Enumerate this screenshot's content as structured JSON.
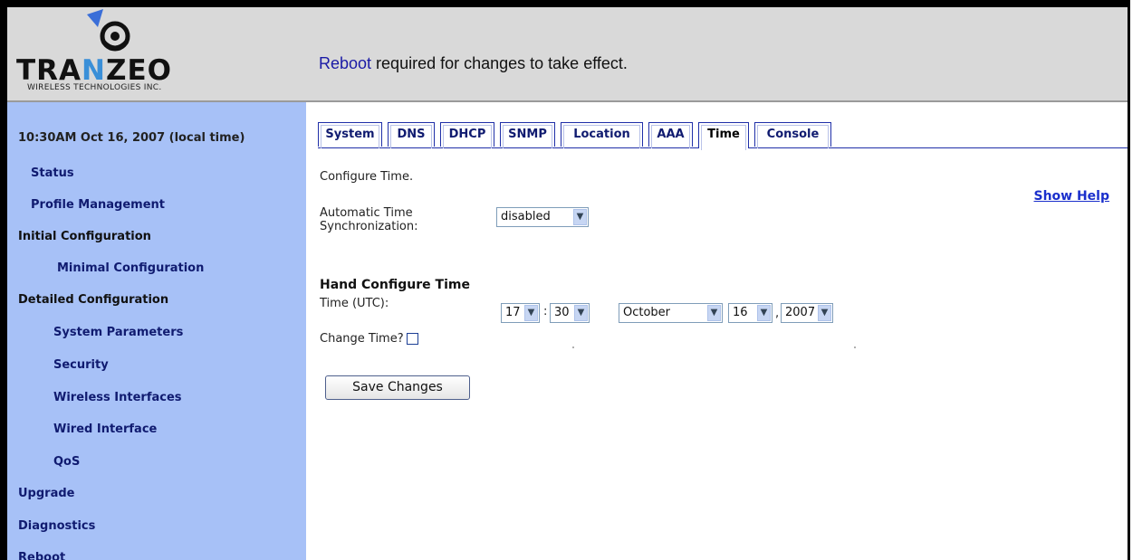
{
  "header": {
    "logo_text_left": "TRA",
    "logo_text_mid": "N",
    "logo_text_right": "ZEO",
    "logo_subtitle": "WIRELESS TECHNOLOGIES INC.",
    "notice_link": "Reboot",
    "notice_rest": " required for changes to take effect."
  },
  "sidebar": {
    "clock": "10:30AM Oct 16, 2007 (local time)",
    "items": [
      {
        "label": "Status"
      },
      {
        "label": "Profile Management"
      },
      {
        "label": "Initial Configuration"
      },
      {
        "label": "Minimal Configuration"
      },
      {
        "label": "Detailed Configuration"
      },
      {
        "label": "System Parameters"
      },
      {
        "label": "Security"
      },
      {
        "label": "Wireless Interfaces"
      },
      {
        "label": "Wired Interface"
      },
      {
        "label": "QoS"
      },
      {
        "label": "Upgrade"
      },
      {
        "label": "Diagnostics"
      },
      {
        "label": "Reboot"
      }
    ]
  },
  "tabs": [
    {
      "label": "System"
    },
    {
      "label": "DNS"
    },
    {
      "label": "DHCP"
    },
    {
      "label": "SNMP"
    },
    {
      "label": "Location"
    },
    {
      "label": "AAA"
    },
    {
      "label": "Time"
    },
    {
      "label": "Console"
    }
  ],
  "page": {
    "intro": "Configure Time.",
    "show_help": "Show Help",
    "auto_sync_label_1": "Automatic Time",
    "auto_sync_label_2": "Synchronization:",
    "auto_sync_value": "disabled",
    "hand_heading": "Hand Configure Time",
    "time_label": "Time (UTC):",
    "hour": "17",
    "minute": "30",
    "month": "October",
    "day": "16",
    "year": "2007",
    "time_sep": ":",
    "date_sep": ",",
    "change_time_label": "Change Time?",
    "change_time_checked": false,
    "save_label": "Save Changes"
  },
  "colors": {
    "sidebar_bg": "#a7c1f7",
    "header_bg": "#d9d9d9",
    "link": "#101b70",
    "tab_border": "#1f2fa8",
    "logo_accent": "#3a8fd8"
  }
}
